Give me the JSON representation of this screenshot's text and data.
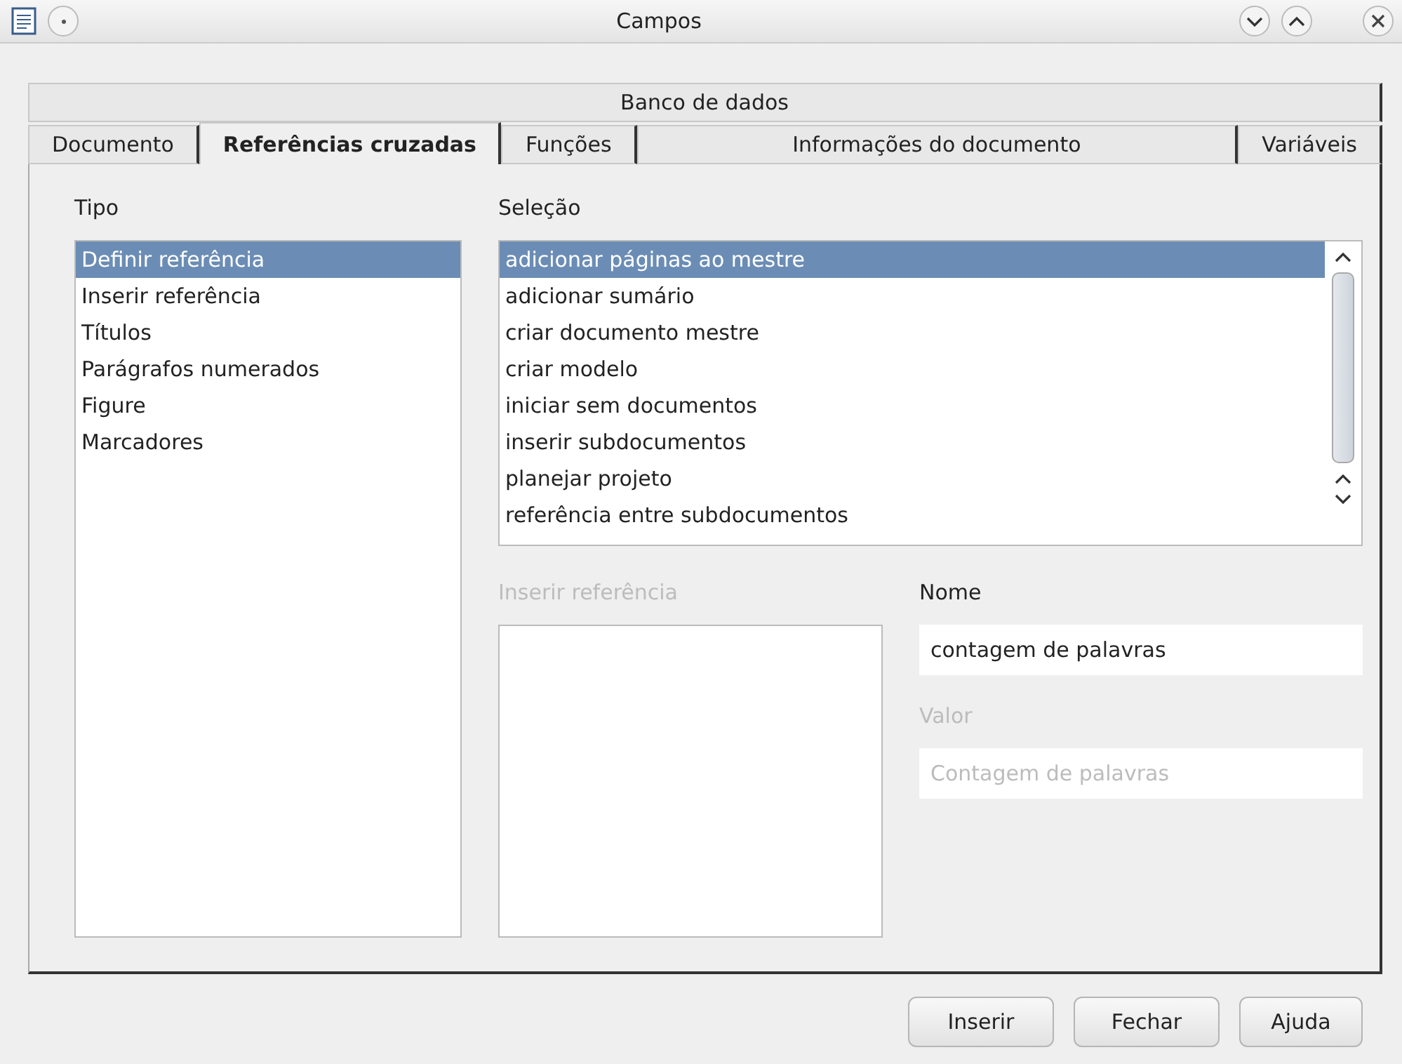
{
  "window": {
    "title": "Campos"
  },
  "tabs_top": [
    {
      "label": "Banco de dados",
      "selected": false
    }
  ],
  "tabs": [
    {
      "label": "Documento",
      "selected": false
    },
    {
      "label": "Referências cruzadas",
      "selected": true
    },
    {
      "label": "Funções",
      "selected": false
    },
    {
      "label": "Informações do documento",
      "selected": false
    },
    {
      "label": "Variáveis",
      "selected": false
    }
  ],
  "tipo": {
    "label": "Tipo",
    "items": [
      {
        "label": "Definir referência",
        "selected": true
      },
      {
        "label": "Inserir referência",
        "selected": false
      },
      {
        "label": "Títulos",
        "selected": false
      },
      {
        "label": "Parágrafos numerados",
        "selected": false
      },
      {
        "label": "Figure",
        "selected": false
      },
      {
        "label": "Marcadores",
        "selected": false
      }
    ]
  },
  "selecao": {
    "label": "Seleção",
    "items": [
      {
        "label": "adicionar páginas ao mestre",
        "selected": true
      },
      {
        "label": "adicionar sumário",
        "selected": false
      },
      {
        "label": "criar documento mestre",
        "selected": false
      },
      {
        "label": "criar modelo",
        "selected": false
      },
      {
        "label": "iniciar sem documentos",
        "selected": false
      },
      {
        "label": "inserir subdocumentos",
        "selected": false
      },
      {
        "label": "planejar projeto",
        "selected": false
      },
      {
        "label": "referência entre subdocumentos",
        "selected": false
      }
    ]
  },
  "inserir_referencia": {
    "label": "Inserir referência",
    "disabled": true
  },
  "nome": {
    "label": "Nome",
    "value": "contagem de palavras",
    "disabled": false
  },
  "valor": {
    "label": "Valor",
    "value": "Contagem de palavras",
    "disabled": true
  },
  "buttons": [
    "Inserir",
    "Fechar",
    "Ajuda"
  ]
}
